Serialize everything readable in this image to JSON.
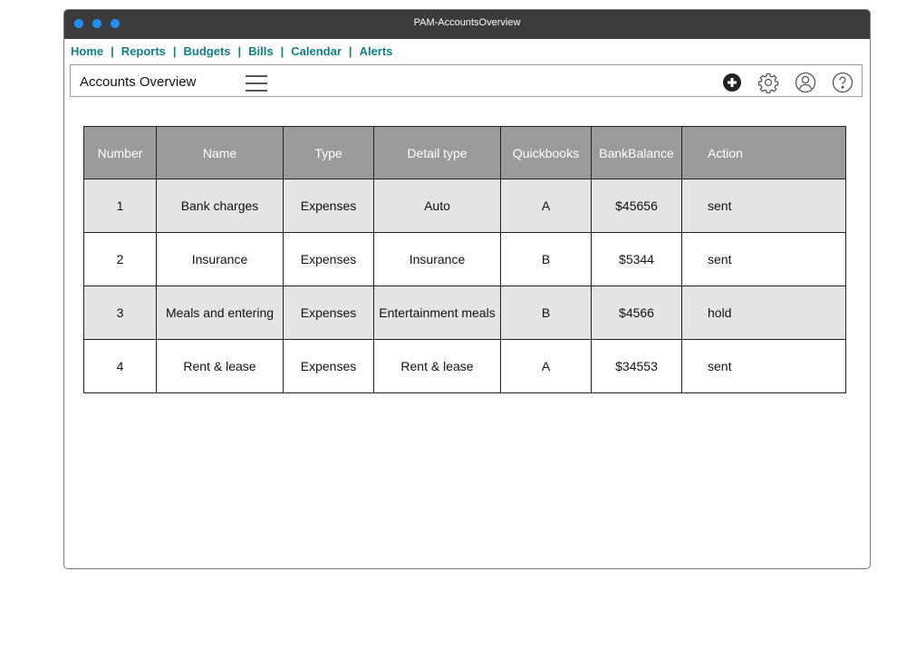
{
  "window": {
    "title": "PAM-AccountsOverview"
  },
  "nav": {
    "items": [
      {
        "label": "Home"
      },
      {
        "label": "Reports"
      },
      {
        "label": "Budgets"
      },
      {
        "label": "Bills"
      },
      {
        "label": "Calendar"
      },
      {
        "label": "Alerts"
      }
    ],
    "separator": "|"
  },
  "toolbar": {
    "title": "Accounts Overview",
    "icons": [
      "menu-icon",
      "add-icon",
      "gear-icon",
      "user-icon",
      "help-icon"
    ]
  },
  "table": {
    "columns": [
      "Number",
      "Name",
      "Type",
      "Detail type",
      "Quickbooks",
      "BankBalance",
      "Action"
    ],
    "rows": [
      {
        "number": "1",
        "name": "Bank charges",
        "type": "Expenses",
        "detail_type": "Auto",
        "quickbooks": "A",
        "bank_balance": "$45656",
        "action": "sent"
      },
      {
        "number": "2",
        "name": "Insurance",
        "type": "Expenses",
        "detail_type": "Insurance",
        "quickbooks": "B",
        "bank_balance": "$5344",
        "action": "sent"
      },
      {
        "number": "3",
        "name": "Meals and entering",
        "type": "Expenses",
        "detail_type": "Entertainment meals",
        "quickbooks": "B",
        "bank_balance": "$4566",
        "action": "hold"
      },
      {
        "number": "4",
        "name": "Rent & lease",
        "type": "Expenses",
        "detail_type": "Rent & lease",
        "quickbooks": "A",
        "bank_balance": "$34553",
        "action": "sent"
      }
    ]
  },
  "colors": {
    "titlebar": "#3b3b3b",
    "window_dots": "#1e90ff",
    "nav_link": "#0f7f86",
    "table_header": "#9b9b9b",
    "row_alt": "#e4e4e4"
  }
}
